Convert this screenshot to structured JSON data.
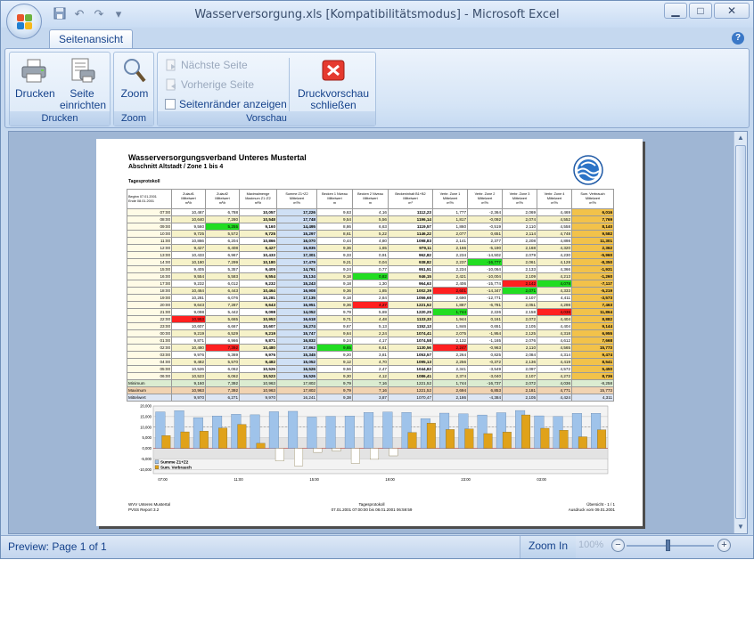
{
  "window": {
    "title": "Wasserversorgung.xls  [Kompatibilitätsmodus] - Microsoft Excel"
  },
  "ribbon": {
    "tab": "Seitenansicht",
    "groups": {
      "drucken": {
        "label": "Drucken",
        "print": "Drucken",
        "setup_l1": "Seite",
        "setup_l2": "einrichten"
      },
      "zoom": {
        "label": "Zoom",
        "zoom": "Zoom"
      },
      "vorschau": {
        "label": "Vorschau",
        "next_page": "Nächste Seite",
        "prev_page": "Vorherige Seite",
        "show_margins": "Seitenränder anzeigen",
        "close_l1": "Druckvorschau",
        "close_l2": "schließen"
      }
    }
  },
  "report": {
    "title": "Wasserversorgungsverband Unteres Mustertal",
    "subtitle": "Abschnitt Altstadt / Zone 1 bis 4",
    "section": "Tagesprotokoll",
    "begin": "Beginn  07.01.2001",
    "end": "Ende     08.01.2001",
    "headers": [
      [
        "Zulauf1",
        "Mittelwert",
        "m³/h"
      ],
      [
        "Zulauf2",
        "Mittelwert",
        "m³/h"
      ],
      [
        "Maximalmenge",
        "Maximum Z1 /Z2",
        "m³/h"
      ],
      [
        "Summe Z1+Z2",
        "Mittelwert",
        "m³/h"
      ],
      [
        "Becken 1 Niveau",
        "Mittelwert",
        "m"
      ],
      [
        "Becken 2 Niveau",
        "Mittelwert",
        "m"
      ],
      [
        "Beckeninhalt B1+B2",
        "Mittelwert",
        "m³"
      ],
      [
        "Verbr. Zone 1",
        "Mittelwert",
        "m³/h"
      ],
      [
        "Verbr. Zone 2",
        "Mittelwert",
        "m³/h"
      ],
      [
        "Verbr. Zone 3",
        "Mittelwert",
        "m³/h"
      ],
      [
        "Verbr. Zone 4",
        "Mittelwert",
        "m³/h"
      ],
      [
        "Sum. Verbrauch",
        "Mittelwert",
        "m³/h"
      ]
    ],
    "rows": [
      [
        "07:00",
        "10,467",
        "6,788",
        "10,057",
        "17,226",
        "9,63",
        "4,16",
        "1112,23",
        "1,777",
        "-2,364",
        "2,069",
        "4,469",
        "6,016"
      ],
      [
        "08:00",
        "10,640",
        "7,280",
        "10,548",
        "17,748",
        "9,54",
        "5,56",
        "1196,14",
        "1,817",
        "-0,092",
        "2,074",
        "4,552",
        "7,769"
      ],
      [
        "09:00",
        "9,560",
        "5,255",
        "9,160",
        "14,495",
        "8,86",
        "6,63",
        "1119,57",
        "1,860",
        "-0,519",
        "2,110",
        "4,558",
        "8,140"
      ],
      [
        "10:00",
        "9,725",
        "5,572",
        "9,725",
        "15,297",
        "8,61",
        "5,22",
        "1146,22",
        "2,077",
        "0,651",
        "2,114",
        "4,748",
        "9,582"
      ],
      [
        "11:00",
        "10,866",
        "6,204",
        "10,866",
        "16,070",
        "0,44",
        "4,80",
        "1098,83",
        "2,141",
        "2,377",
        "2,208",
        "4,898",
        "11,301"
      ],
      [
        "12:00",
        "9,427",
        "6,408",
        "9,427",
        "15,835",
        "9,36",
        "1,65",
        "979,11",
        "2,166",
        "-5,190",
        "2,168",
        "4,320",
        "2,362"
      ],
      [
        "13:00",
        "10,433",
        "6,967",
        "10,433",
        "17,301",
        "9,33",
        "0,91",
        "962,82",
        "2,234",
        "-14,502",
        "2,079",
        "4,230",
        "-5,960"
      ],
      [
        "14:00",
        "10,180",
        "7,299",
        "10,180",
        "17,479",
        "9,21",
        "0,04",
        "938,82",
        "2,237",
        "-16,777",
        "2,061",
        "4,128",
        "-8,350"
      ],
      [
        "15:00",
        "9,405",
        "5,357",
        "9,405",
        "14,761",
        "9,24",
        "0,77",
        "951,51",
        "2,234",
        "-10,064",
        "2,133",
        "4,366",
        "-1,931"
      ],
      [
        "16:00",
        "9,554",
        "5,583",
        "9,554",
        "15,134",
        "9,18",
        "0,82",
        "946,15",
        "2,421",
        "-10,004",
        "2,109",
        "4,213",
        "-1,260"
      ],
      [
        "17:00",
        "9,232",
        "6,012",
        "9,232",
        "15,243",
        "9,18",
        "1,30",
        "964,63",
        "2,406",
        "-15,774",
        "2,142",
        "4,078",
        "-7,117"
      ],
      [
        "18:00",
        "10,464",
        "6,443",
        "10,464",
        "16,908",
        "9,36",
        "1,85",
        "1002,39",
        "2,601",
        "-14,347",
        "2,071",
        "4,333",
        "-5,219"
      ],
      [
        "19:00",
        "10,281",
        "6,076",
        "10,281",
        "17,135",
        "9,18",
        "2,84",
        "1056,68",
        "2,690",
        "-12,771",
        "2,107",
        "4,411",
        "-3,573"
      ],
      [
        "20:00",
        "9,643",
        "7,287",
        "9,643",
        "16,951",
        "9,36",
        "4,27",
        "1221,52",
        "1,887",
        "-6,781",
        "2,051",
        "4,298",
        "7,463"
      ],
      [
        "21:00",
        "9,098",
        "5,442",
        "9,098",
        "14,052",
        "9,79",
        "5,69",
        "1220,25",
        "1,744",
        "2,226",
        "2,158",
        "4,036",
        "11,864"
      ],
      [
        "22:00",
        "10,953",
        "5,665",
        "10,953",
        "16,618",
        "9,71",
        "4,48",
        "1133,33",
        "1,944",
        "0,161",
        "2,072",
        "4,404",
        "8,882"
      ],
      [
        "23:00",
        "10,607",
        "6,667",
        "10,607",
        "16,274",
        "9,67",
        "5,13",
        "1152,13",
        "1,846",
        "0,651",
        "2,105",
        "4,404",
        "9,144"
      ],
      [
        "00:00",
        "9,219",
        "6,529",
        "9,219",
        "15,747",
        "9,64",
        "2,24",
        "1074,41",
        "2,075",
        "-1,954",
        "2,125",
        "4,318",
        "6,955"
      ],
      [
        "01:00",
        "9,871",
        "6,966",
        "9,871",
        "16,832",
        "9,24",
        "4,17",
        "1074,58",
        "2,132",
        "-1,165",
        "2,076",
        "4,612",
        "7,668"
      ],
      [
        "02:00",
        "10,480",
        "7,392",
        "10,480",
        "17,862",
        "9,65",
        "6,61",
        "1130,56",
        "2,247",
        "-0,963",
        "2,110",
        "4,565",
        "15,773"
      ],
      [
        "03:00",
        "9,976",
        "5,369",
        "9,976",
        "15,345",
        "9,20",
        "3,81",
        "1053,57",
        "2,264",
        "0,825",
        "2,084",
        "4,314",
        "9,474"
      ],
      [
        "04:00",
        "9,482",
        "5,570",
        "9,482",
        "15,052",
        "9,12",
        "4,70",
        "1095,13",
        "2,256",
        "-0,372",
        "2,136",
        "4,419",
        "8,541"
      ],
      [
        "05:00",
        "10,526",
        "6,062",
        "10,526",
        "16,526",
        "9,56",
        "2,47",
        "1044,82",
        "2,341",
        "-3,549",
        "2,097",
        "4,572",
        "5,450"
      ],
      [
        "06:00",
        "10,523",
        "6,062",
        "10,523",
        "16,526",
        "9,30",
        "4,12",
        "1086,41",
        "2,374",
        "-3,040",
        "2,107",
        "4,272",
        "8,736"
      ]
    ],
    "min": [
      "Minimum",
      "9,160",
      "7,392",
      "10,963",
      "17,802",
      "9,79",
      "7,16",
      "1221,52",
      "1,744",
      "-16,737",
      "2,072",
      "4,036",
      "-8,258"
    ],
    "max": [
      "Maximum",
      "10,963",
      "7,392",
      "10,963",
      "17,802",
      "9,79",
      "7,16",
      "1221,52",
      "2,694",
      "6,853",
      "2,181",
      "4,771",
      "15,773"
    ],
    "avg": [
      "Mittelwert",
      "9,970",
      "6,271",
      "9,970",
      "16,241",
      "9,38",
      "3,87",
      "1070,47",
      "2,186",
      "-4,384",
      "2,105",
      "4,424",
      "4,311"
    ],
    "chart_data": {
      "type": "bar",
      "categories": [
        "07:00",
        "08:00",
        "09:00",
        "10:00",
        "11:00",
        "12:00",
        "13:00",
        "14:00",
        "15:00",
        "16:00",
        "17:00",
        "18:00",
        "19:00",
        "20:00",
        "21:00",
        "22:00",
        "23:00",
        "00:00",
        "01:00",
        "02:00",
        "03:00",
        "04:00",
        "05:00",
        "06:00"
      ],
      "x_ticks": [
        "07:00",
        "11:00",
        "15:00",
        "19:00",
        "23:00",
        "03:00"
      ],
      "y_ticks": [
        "20,000",
        "15,000",
        "10,000",
        "5,000",
        "0,000",
        "-5,000",
        "-10,000"
      ],
      "ylim": [
        -12000,
        20000
      ],
      "series": [
        {
          "name": "Summe Z1+Z2",
          "color": "#9fc3ea",
          "values": [
            17226,
            17748,
            14495,
            15297,
            16070,
            15835,
            17301,
            17479,
            14761,
            15134,
            15243,
            16908,
            17135,
            16951,
            14052,
            16618,
            16274,
            15747,
            16832,
            17862,
            15345,
            15052,
            16526,
            16526
          ]
        },
        {
          "name": "Sum. Verbrauch",
          "color": "#e0a21a",
          "values": [
            6016,
            7769,
            8140,
            9582,
            11301,
            2362,
            -5960,
            -8350,
            -1931,
            -1260,
            -7117,
            -5219,
            -3573,
            7463,
            11864,
            8882,
            9144,
            6955,
            7668,
            15773,
            9474,
            8541,
            5450,
            8736
          ]
        }
      ]
    },
    "footer": {
      "left1": "WVV Unteres Mustertal",
      "left2": "PVSS Report 3.2",
      "center1": "Tagesprotokoll",
      "center2": "07.01.2001 07:00:00 bis 08.01.2001 06:59:59",
      "right1": "Übersicht - 1 / 1",
      "right2": "Ausdruck vom 09.01.2001"
    }
  },
  "status": {
    "preview": "Preview: Page 1 of 1",
    "zoom_in": "Zoom In",
    "zoom_level": "100%"
  }
}
